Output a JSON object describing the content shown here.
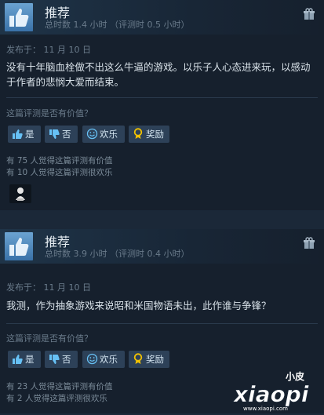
{
  "reviews": [
    {
      "title": "推荐",
      "hours": "总时数 1.4 小时  （评测时 0.5 小时）",
      "posted": "发布于：  11 月 10 日",
      "text": "没有十年脑血栓做不出这么牛逼的游戏。以乐子人心态进来玩，以感动于作者的悲悯大爱而结束。",
      "helpful_question": "这篇评测是否有价值？",
      "buttons": {
        "yes": "是",
        "no": "否",
        "funny": "欢乐",
        "award": "奖励"
      },
      "helpful_count": "有 75 人觉得这篇评测有价值",
      "funny_count": "有 10 人觉得这篇评测很欢乐"
    },
    {
      "title": "推荐",
      "hours": "总时数 3.9 小时  （评测时 0.4 小时）",
      "posted": "发布于：  11 月 10 日",
      "text": "我测，作为抽象游戏来说昭和米国物语未出，此作谁与争锋？",
      "helpful_question": "这篇评测是否有价值？",
      "buttons": {
        "yes": "是",
        "no": "否",
        "funny": "欢乐",
        "award": "奖励"
      },
      "helpful_count": "有 23 人觉得这篇评测有价值",
      "funny_count": "有 2 人觉得这篇评测很欢乐"
    }
  ],
  "watermark": {
    "top": "小皮",
    "main": "xiaopi",
    "sub": "www.xiaopi.com"
  },
  "colors": {
    "background": "#1b2838",
    "review_bg": "#16202d",
    "button_bg": "#2d4158",
    "award_yellow": "#f2c200"
  },
  "icons": [
    "thumbs-up-icon",
    "gift-icon",
    "thumbs-down-icon",
    "smiley-icon",
    "award-icon",
    "avatar"
  ]
}
